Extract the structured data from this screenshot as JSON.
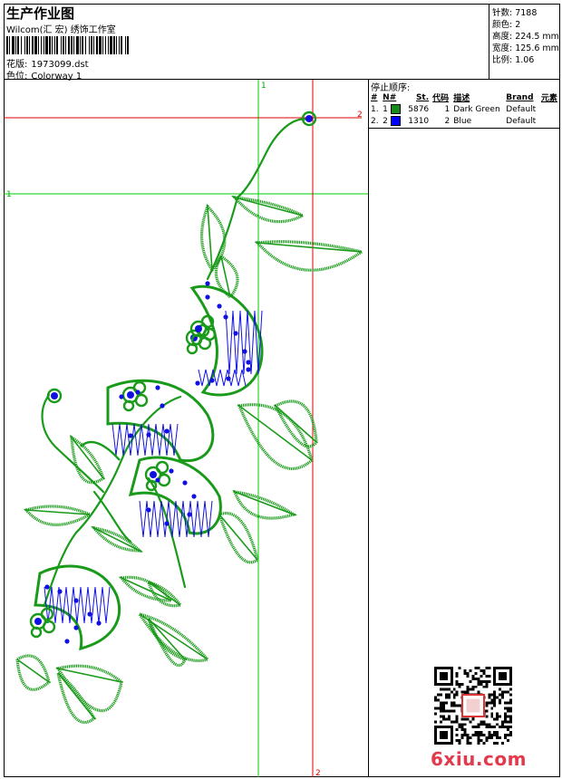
{
  "header": {
    "title": "生产作业图",
    "company": "Wilcom(汇 宏) 绣饰工作室",
    "design_label": "花版:",
    "design_value": "1973099.dst",
    "colorway_label": "色位:",
    "colorway_value": "Colorway 1"
  },
  "stats": {
    "stitches_label": "针数:",
    "stitches_value": "7188",
    "colors_label": "颜色:",
    "colors_value": "2",
    "height_label": "高度:",
    "height_value": "224.5 mm",
    "width_label": "宽度:",
    "width_value": "125.6 mm",
    "scale_label": "比例:",
    "scale_value": "1.06"
  },
  "guides": {
    "label_1": "1",
    "label_2": "2",
    "color_green": "#00cc00",
    "color_red": "#e00000"
  },
  "stops": {
    "title": "停止顺序:",
    "columns": [
      "#",
      "N#",
      "St.",
      "代码",
      "描述",
      "Brand",
      "元素"
    ],
    "rows": [
      {
        "index": "1.",
        "n": "1",
        "swatch": "#1a8a1a",
        "stitches": "5876",
        "code": "1",
        "description": "Dark Green",
        "brand": "Default"
      },
      {
        "index": "2.",
        "n": "2",
        "swatch": "#0000ff",
        "stitches": "1310",
        "code": "2",
        "description": "Blue",
        "brand": "Default"
      }
    ]
  },
  "colors": {
    "thread_green": "#1a9a1a",
    "thread_blue": "#1010e0"
  },
  "watermark": "6xiu.com"
}
